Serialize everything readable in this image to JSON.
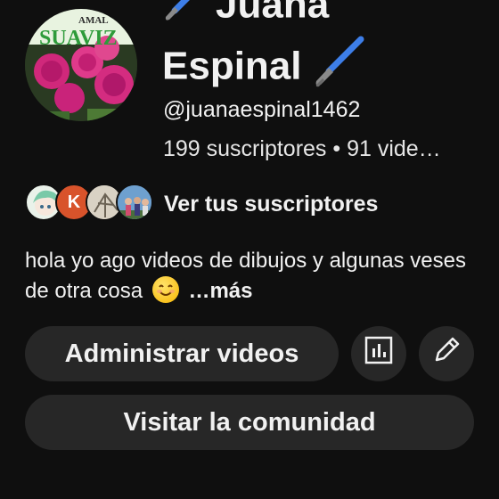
{
  "channel": {
    "name_line1": "Juana",
    "name_line2": "Espinal",
    "handle": "@juanaespinal1462",
    "stats": "199 suscriptores • 91 vide…",
    "avatar_text_top": "AMAL",
    "avatar_text_main": "SUAVIZ"
  },
  "subscribers": {
    "label": "Ver tus suscriptores",
    "avatars": [
      {
        "name": "anime-avatar"
      },
      {
        "letter": "K"
      },
      {
        "name": "drawing-avatar"
      },
      {
        "name": "group-photo-avatar"
      }
    ]
  },
  "description": {
    "text": "hola yo ago videos de dibujos  y algunas veses de otra cosa",
    "more": "…más"
  },
  "actions": {
    "manage_videos": "Administrar videos",
    "visit_community": "Visitar la comunidad",
    "stats_icon": "analytics-icon",
    "edit_icon": "pencil-icon"
  },
  "colors": {
    "background": "#0f0f0f",
    "button": "#272727",
    "k_avatar": "#d8532b"
  }
}
